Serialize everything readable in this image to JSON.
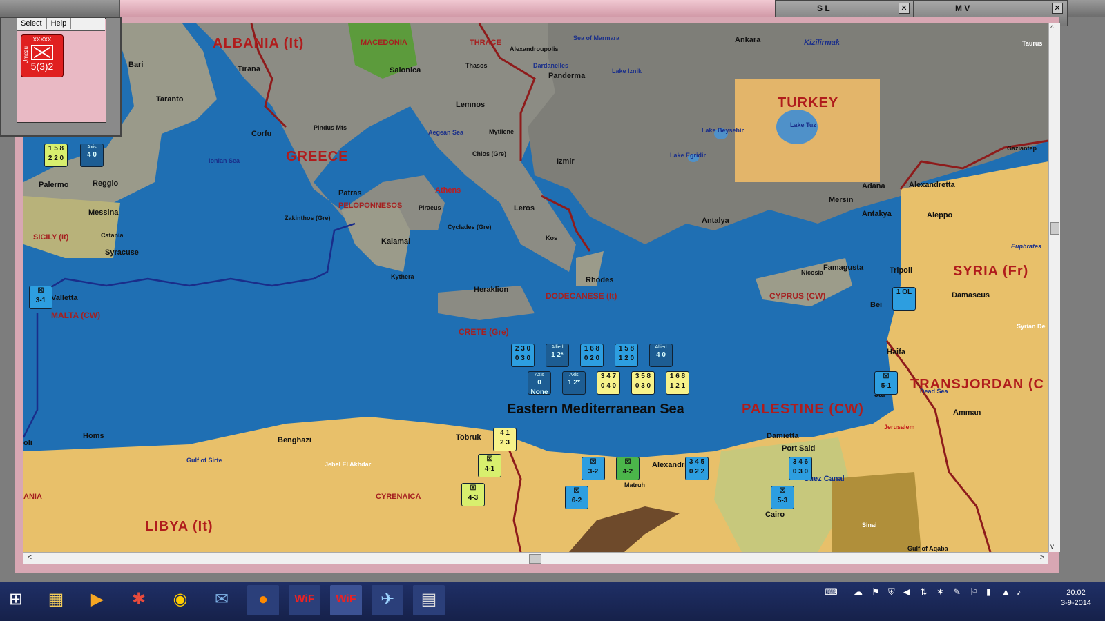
{
  "windows": {
    "main_titlebar_color": "#d29aa8",
    "sub_windows": [
      {
        "title": "S L"
      },
      {
        "title": "M V"
      }
    ]
  },
  "left_panel": {
    "menu": [
      "Select",
      "Help"
    ],
    "unit": {
      "size": "XXXXX",
      "side": "Umezu",
      "value": "5(3)2",
      "color": "#e02020"
    }
  },
  "map": {
    "countries": [
      {
        "name": "ALBANIA (It)"
      },
      {
        "name": "TURKEY"
      },
      {
        "name": "GREECE"
      },
      {
        "name": "SYRIA (Fr)"
      },
      {
        "name": "TRANSJORDAN (C"
      },
      {
        "name": "PALESTINE (CW)"
      },
      {
        "name": "LIBYA (It)"
      }
    ],
    "regions": [
      {
        "name": "MACEDONIA"
      },
      {
        "name": "THRACE"
      },
      {
        "name": "PELOPONNESOS"
      },
      {
        "name": "SICILY (It)"
      },
      {
        "name": "MALTA (CW)"
      },
      {
        "name": "DODECANESE (It)"
      },
      {
        "name": "CYPRUS (CW)"
      },
      {
        "name": "CRETE (Gre)"
      },
      {
        "name": "CYRENAICA"
      },
      {
        "name": "ANIA"
      }
    ],
    "sea_title": "Eastern Mediterranean Sea",
    "seas": [
      {
        "name": "Sea of Marmara"
      },
      {
        "name": "Aegean Sea"
      },
      {
        "name": "Ionian Sea"
      },
      {
        "name": "Gulf of Sirte"
      },
      {
        "name": "Gulf of Aqaba"
      },
      {
        "name": "Dead Sea"
      },
      {
        "name": "Kizilirmak"
      },
      {
        "name": "Euphrates"
      },
      {
        "name": "Lake Iznik"
      },
      {
        "name": "Lake Tuz"
      },
      {
        "name": "Lake Beysehir"
      },
      {
        "name": "Lake Egridir"
      },
      {
        "name": "Dardanelles"
      }
    ],
    "cities": [
      {
        "name": "Bari"
      },
      {
        "name": "Taranto"
      },
      {
        "name": "Tirana"
      },
      {
        "name": "Salonica"
      },
      {
        "name": "Alexandroupolis"
      },
      {
        "name": "Thasos"
      },
      {
        "name": "Lemnos"
      },
      {
        "name": "Mytilene"
      },
      {
        "name": "Chios (Gre)"
      },
      {
        "name": "Izmir"
      },
      {
        "name": "Ankara"
      },
      {
        "name": "Panderma"
      },
      {
        "name": "Corfu"
      },
      {
        "name": "Pindus Mts"
      },
      {
        "name": "Patras"
      },
      {
        "name": "Athens"
      },
      {
        "name": "Piraeus"
      },
      {
        "name": "Zakinthos (Gre)"
      },
      {
        "name": "Cyclades (Gre)"
      },
      {
        "name": "Kalamai"
      },
      {
        "name": "Kythera"
      },
      {
        "name": "Leros"
      },
      {
        "name": "Kos"
      },
      {
        "name": "Rhodes"
      },
      {
        "name": "Heraklion"
      },
      {
        "name": "Palermo"
      },
      {
        "name": "Reggio"
      },
      {
        "name": "Messina"
      },
      {
        "name": "Catania"
      },
      {
        "name": "Syracuse"
      },
      {
        "name": "Valletta"
      },
      {
        "name": "Antalya"
      },
      {
        "name": "Mersin"
      },
      {
        "name": "Adana"
      },
      {
        "name": "Alexandretta"
      },
      {
        "name": "Gaziantep"
      },
      {
        "name": "Antakya"
      },
      {
        "name": "Aleppo"
      },
      {
        "name": "Tripoli"
      },
      {
        "name": "Damascus"
      },
      {
        "name": "Famagusta"
      },
      {
        "name": "Nicosia"
      },
      {
        "name": "Haifa"
      },
      {
        "name": "Jerusalem"
      },
      {
        "name": "Amman"
      },
      {
        "name": "Damietta"
      },
      {
        "name": "Port Said"
      },
      {
        "name": "Suez Canal"
      },
      {
        "name": "Cairo"
      },
      {
        "name": "Sinai"
      },
      {
        "name": "Alexandria"
      },
      {
        "name": "Matruh"
      },
      {
        "name": "Tobruk"
      },
      {
        "name": "Benghazi"
      },
      {
        "name": "Jebel El Akhdar"
      },
      {
        "name": "Homs"
      },
      {
        "name": "Taurus"
      },
      {
        "name": "Syrian De"
      },
      {
        "name": "Bei"
      },
      {
        "name": "Jaf"
      },
      {
        "name": "oli"
      }
    ],
    "counters": [
      {
        "id": "c1",
        "color": "lime",
        "top": "1 5 8",
        "bottom": "2 2 0"
      },
      {
        "id": "c2",
        "color": "dark",
        "top": "Axis",
        "bottom": "4 0"
      },
      {
        "id": "c3",
        "color": "blue",
        "top": "2 3 0",
        "bottom": "0 3 0"
      },
      {
        "id": "c4",
        "color": "dark",
        "top": "Allied",
        "bottom": "1 2*"
      },
      {
        "id": "c5",
        "color": "blue",
        "top": "1 6 8",
        "bottom": "0 2 0"
      },
      {
        "id": "c6",
        "color": "blue",
        "top": "1 5 8",
        "bottom": "1 2 0"
      },
      {
        "id": "c7",
        "color": "dark",
        "top": "Allied",
        "bottom": "4 0"
      },
      {
        "id": "c8",
        "color": "dark",
        "top": "Axis",
        "bottom": "0 None"
      },
      {
        "id": "c9",
        "color": "dark",
        "top": "Axis",
        "bottom": "1 2*"
      },
      {
        "id": "c10",
        "color": "yellow",
        "top": "3 4 7",
        "bottom": "0 4 0"
      },
      {
        "id": "c11",
        "color": "yellow",
        "top": "3 5 8",
        "bottom": "0 3 0"
      },
      {
        "id": "c12",
        "color": "yellow",
        "top": "1 6 8",
        "bottom": "1 2 1"
      },
      {
        "id": "c13",
        "color": "yellow",
        "top": "4 1",
        "bottom": "2 3"
      },
      {
        "id": "c14",
        "color": "lime",
        "top": "",
        "bottom": "4-1"
      },
      {
        "id": "c15",
        "color": "lime",
        "top": "",
        "bottom": "4-3"
      },
      {
        "id": "c16",
        "color": "blue",
        "top": "",
        "bottom": "3-2"
      },
      {
        "id": "c17",
        "color": "blue",
        "top": "",
        "bottom": "4-2"
      },
      {
        "id": "c18",
        "color": "blue",
        "top": "",
        "bottom": "6-2"
      },
      {
        "id": "c19",
        "color": "blue",
        "top": "3 4 5",
        "bottom": "0 2 2"
      },
      {
        "id": "c20",
        "color": "blue",
        "top": "3 4 6",
        "bottom": "0 3 0"
      },
      {
        "id": "c21",
        "color": "blue",
        "top": "",
        "bottom": "5-3"
      },
      {
        "id": "c22",
        "color": "blue",
        "top": "",
        "bottom": "5-1"
      },
      {
        "id": "c23",
        "color": "blue",
        "top": "",
        "bottom": "3-1"
      },
      {
        "id": "c24",
        "color": "blue",
        "top": "1 OL",
        "bottom": ""
      }
    ]
  },
  "taskbar": {
    "apps": [
      {
        "name": "windows-start"
      },
      {
        "name": "file-explorer"
      },
      {
        "name": "media-player"
      },
      {
        "name": "paint-app"
      },
      {
        "name": "color-picker"
      },
      {
        "name": "thunderbird"
      },
      {
        "name": "firefox"
      },
      {
        "name": "wif-1"
      },
      {
        "name": "wif-2"
      },
      {
        "name": "flight-app"
      },
      {
        "name": "doc-app"
      }
    ],
    "clock": {
      "time": "20:02",
      "date": "3-9-2014"
    }
  },
  "colors": {
    "sea": "#1f6fb3",
    "shallow": "#5aa3d6",
    "desert": "#e8c06a",
    "mountain": "#8f8f8f",
    "border": "#8e1b1b",
    "taskbar": "#1a2655",
    "pink_frame": "#e2b0bd"
  }
}
